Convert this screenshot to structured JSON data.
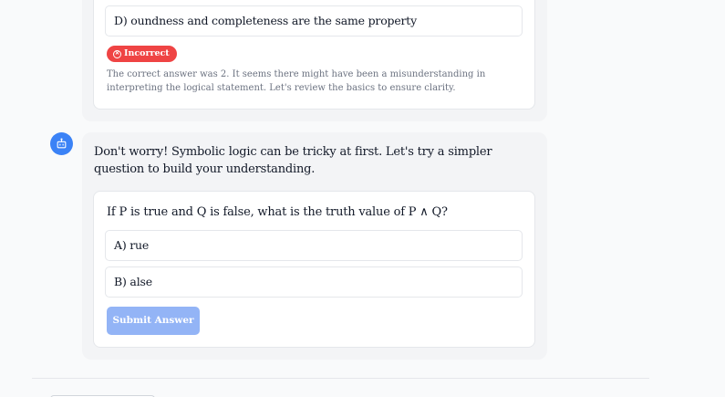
{
  "previous_question": {
    "option_d": "D) oundness and completeness are the same property",
    "result_badge": "Incorrect",
    "result_icon": "x-circle-icon",
    "explanation": "The correct answer was 2. It seems there might have been a misunderstanding in interpreting the logical statement. Let's review the basics to ensure clarity."
  },
  "assistant": {
    "avatar_icon": "robot-icon",
    "message": "Don't worry! Symbolic logic can be tricky at first. Let's try a simpler question to build your understanding."
  },
  "current_question": {
    "prompt": "If P is true and Q is false, what is the truth value of P ∧ Q?",
    "options": [
      "A) rue",
      "B) alse"
    ],
    "submit_label": "Submit Answer"
  },
  "colors": {
    "incorrect": "#ef4444",
    "accent": "#3b82f6",
    "submit_disabled": "#93b4f6"
  }
}
